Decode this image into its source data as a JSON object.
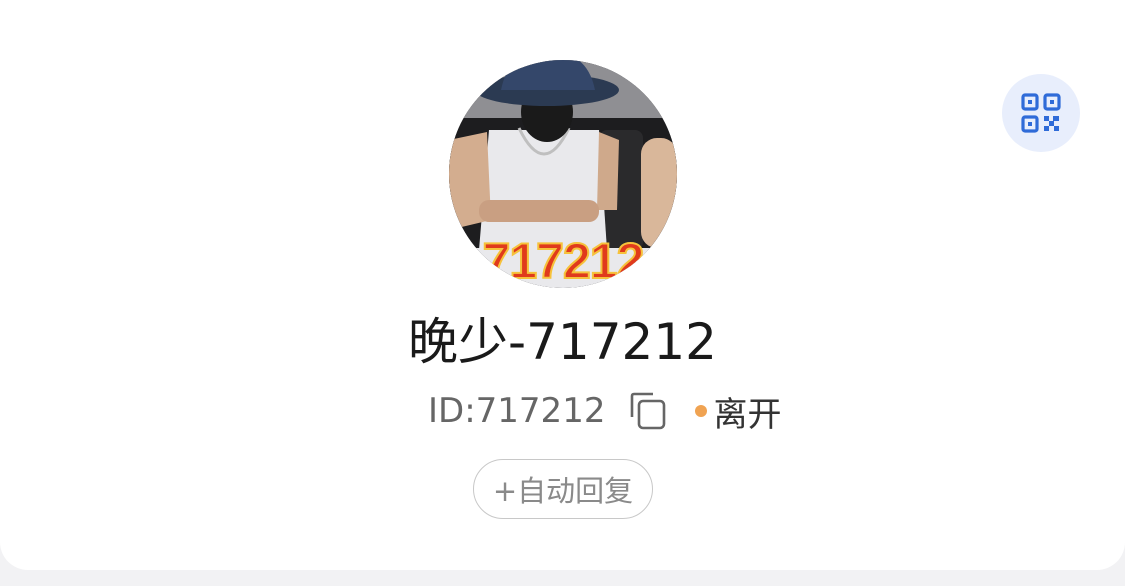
{
  "profile": {
    "avatar_caption": "717212",
    "name": "晚少-717212",
    "id_label": "ID:717212",
    "status_text": "离开",
    "status_color": "#f0a352"
  },
  "actions": {
    "auto_reply_label": "+自动回复",
    "qr_icon": "qr-code-icon",
    "copy_icon": "copy-icon"
  },
  "colors": {
    "accent": "#2f6bd8",
    "qr_bg": "#e8eefc"
  }
}
